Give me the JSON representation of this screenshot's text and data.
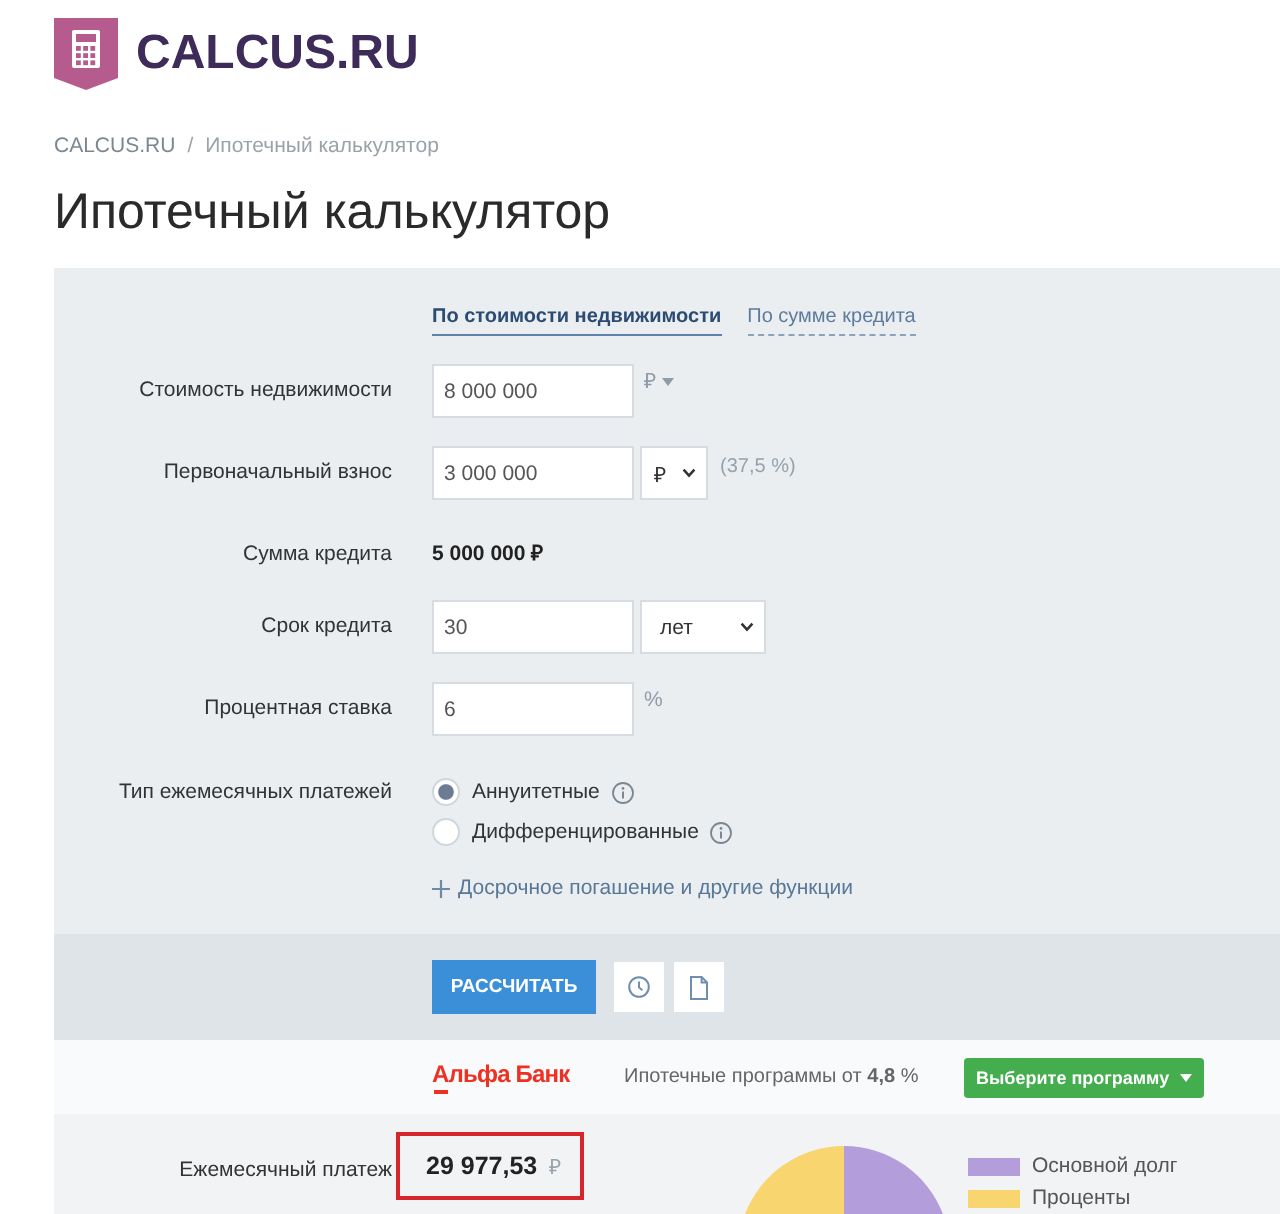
{
  "header": {
    "logo_text": "CALCUS.RU"
  },
  "breadcrumbs": {
    "items": [
      "CALCUS.RU",
      "Ипотечный калькулятор"
    ],
    "separator": "/"
  },
  "page_title": "Ипотечный калькулятор",
  "calculator": {
    "tabs": [
      {
        "label": "По стоимости недвижимости",
        "selected": true
      },
      {
        "label": "По сумме кредита",
        "selected": false
      }
    ],
    "fields": [
      {
        "kind": "input",
        "label": "Стоимость недвижимости",
        "value": "8 000 000",
        "unit": "₽",
        "unit_dropdown": true
      },
      {
        "kind": "input",
        "label": "Первоначальный взнос",
        "value": "3 000 000",
        "select": "₽",
        "note": "(37,5 %)"
      },
      {
        "kind": "readout",
        "label": "Сумма кредита",
        "value": "5 000 000 ₽"
      },
      {
        "kind": "input",
        "label": "Срок кредита",
        "value": "30",
        "select": "лет"
      },
      {
        "kind": "input",
        "label": "Процентная ставка",
        "value": "6",
        "unit": "%",
        "unit_dropdown": false
      },
      {
        "kind": "radio",
        "label": "Тип ежемесячных платежей",
        "options": [
          {
            "label": "Аннуитетные",
            "selected": true
          },
          {
            "label": "Дифференцированные",
            "selected": false
          }
        ]
      }
    ],
    "more_link": "Досрочное погашение и другие функции",
    "calculate_button": "РАССЧИТАТЬ"
  },
  "bank_offer": {
    "bank": "Альфа Банк",
    "text": "Ипотечные программы от **4,8** %",
    "button": "Выберите программу"
  },
  "result": {
    "label": "Ежемесячный платеж",
    "value": "29 977,53",
    "currency": "₽",
    "legend": [
      {
        "label": "Основной долг",
        "color": "#b39ddb"
      },
      {
        "label": "Проценты",
        "color": "#f8d56f"
      }
    ]
  }
}
